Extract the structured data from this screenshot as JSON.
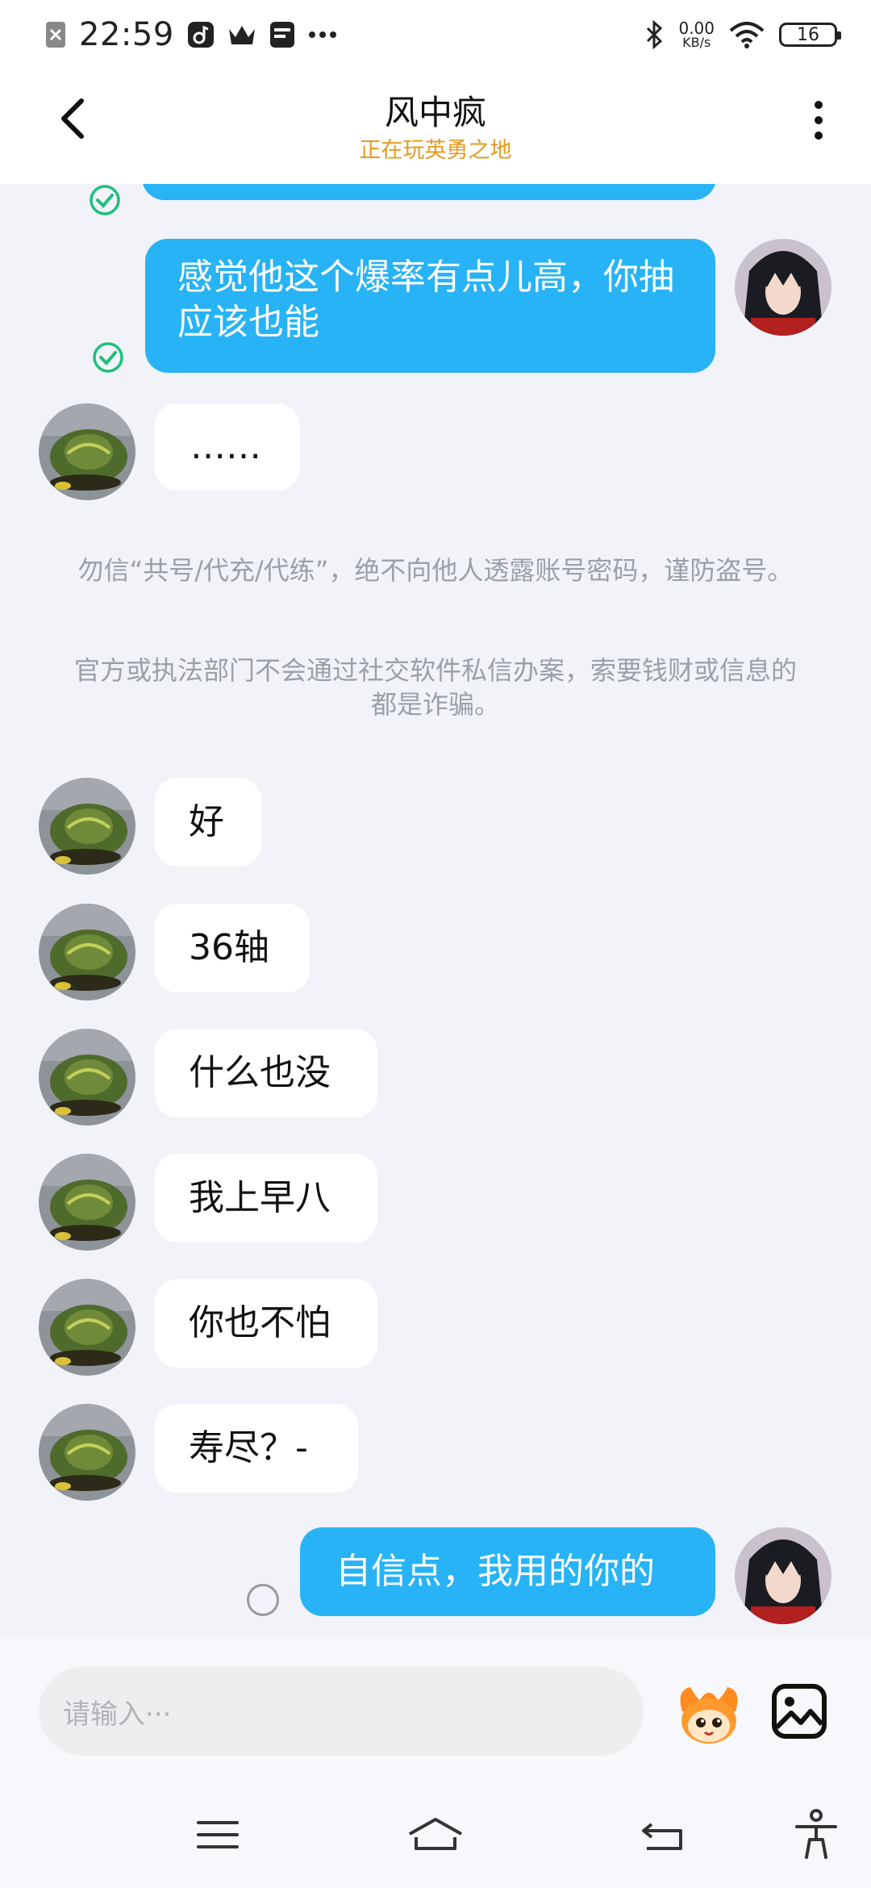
{
  "status_bar": {
    "time": "22:59",
    "net_speed_value": "0.00",
    "net_speed_unit": "KB/s",
    "battery_level": "16"
  },
  "header": {
    "title": "风中疯",
    "subtitle": "正在玩英勇之地",
    "colors": {
      "subtitle": "#e69a1e"
    }
  },
  "messages": [
    {
      "from": "me",
      "text": "感觉他这个爆率有点儿高，你抽应该也能",
      "status": "read"
    },
    {
      "from": "them",
      "text": "……"
    },
    {
      "from": "them",
      "text": "好"
    },
    {
      "from": "them",
      "text": "36轴"
    },
    {
      "from": "them",
      "text": "什么也没"
    },
    {
      "from": "them",
      "text": "我上早八"
    },
    {
      "from": "them",
      "text": "你也不怕"
    },
    {
      "from": "them",
      "text": "寿尽？-"
    },
    {
      "from": "me",
      "text": "自信点，我用的你的",
      "status": "sending"
    }
  ],
  "notices": [
    "勿信“共号/代充/代练”，绝不向他人透露账号密码，谨防盗号。",
    "官方或执法部门不会通过社交软件私信办案，索要钱财或信息的都是诈骗。"
  ],
  "input": {
    "placeholder": "请输入···"
  },
  "colors": {
    "my_bubble": "#27b3f6",
    "their_bubble": "#ffffff",
    "read_check": "#1fbf7a",
    "background": "#f1f3f8"
  },
  "icons": {
    "back": "chevron-left-icon",
    "more": "more-vertical-icon",
    "emoji": "mascot-emoji-icon",
    "image": "image-icon",
    "nav": [
      "menu-icon",
      "home-icon",
      "back-icon",
      "accessibility-icon"
    ]
  }
}
